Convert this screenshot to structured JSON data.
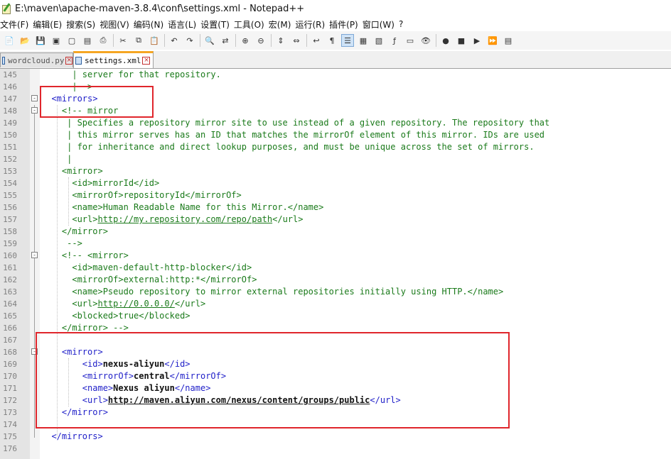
{
  "window": {
    "title": "E:\\maven\\apache-maven-3.8.4\\conf\\settings.xml - Notepad++"
  },
  "menu": [
    "文件(F)",
    "编辑(E)",
    "搜索(S)",
    "视图(V)",
    "编码(N)",
    "语言(L)",
    "设置(T)",
    "工具(O)",
    "宏(M)",
    "运行(R)",
    "插件(P)",
    "窗口(W)",
    "?"
  ],
  "toolbar": [
    {
      "name": "new-file-icon",
      "glyph": "📄"
    },
    {
      "name": "open-file-icon",
      "glyph": "📂"
    },
    {
      "name": "save-icon",
      "glyph": "💾"
    },
    {
      "name": "save-all-icon",
      "glyph": "▣"
    },
    {
      "name": "close-icon",
      "glyph": "▢"
    },
    {
      "name": "close-all-icon",
      "glyph": "▤"
    },
    {
      "name": "print-icon",
      "glyph": "⎙"
    },
    {
      "sep": true
    },
    {
      "name": "cut-icon",
      "glyph": "✂"
    },
    {
      "name": "copy-icon",
      "glyph": "⧉"
    },
    {
      "name": "paste-icon",
      "glyph": "📋"
    },
    {
      "sep": true
    },
    {
      "name": "undo-icon",
      "glyph": "↶"
    },
    {
      "name": "redo-icon",
      "glyph": "↷"
    },
    {
      "sep": true
    },
    {
      "name": "find-icon",
      "glyph": "🔍"
    },
    {
      "name": "replace-icon",
      "glyph": "⇄"
    },
    {
      "sep": true
    },
    {
      "name": "zoom-in-icon",
      "glyph": "⊕"
    },
    {
      "name": "zoom-out-icon",
      "glyph": "⊖"
    },
    {
      "sep": true
    },
    {
      "name": "sync-vertical-icon",
      "glyph": "⇕"
    },
    {
      "name": "sync-horizontal-icon",
      "glyph": "⇔"
    },
    {
      "sep": true
    },
    {
      "name": "word-wrap-icon",
      "glyph": "↩"
    },
    {
      "name": "show-all-chars-icon",
      "glyph": "¶"
    },
    {
      "name": "indent-guide-icon",
      "glyph": "☰",
      "pressed": true
    },
    {
      "name": "udl-icon",
      "glyph": "▦"
    },
    {
      "name": "doc-map-icon",
      "glyph": "▧"
    },
    {
      "name": "function-list-icon",
      "glyph": "ƒ"
    },
    {
      "name": "folder-workspace-icon",
      "glyph": "▭"
    },
    {
      "name": "monitoring-icon",
      "glyph": "👁"
    },
    {
      "sep": true
    },
    {
      "name": "record-macro-icon",
      "glyph": "●"
    },
    {
      "name": "stop-macro-icon",
      "glyph": "■"
    },
    {
      "name": "play-macro-icon",
      "glyph": "▶"
    },
    {
      "name": "run-macro-multiple-icon",
      "glyph": "⏩"
    },
    {
      "name": "save-macro-icon",
      "glyph": "▤"
    }
  ],
  "tabs": [
    {
      "label": "wordcloud.py",
      "active": false
    },
    {
      "label": "settings.xml",
      "active": true
    }
  ],
  "lines": [
    {
      "n": "145",
      "segs": [
        [
          "      | server for that repository.",
          "cm"
        ]
      ]
    },
    {
      "n": "146",
      "segs": [
        [
          "      |-->",
          "cm"
        ]
      ]
    },
    {
      "n": "147",
      "fold": "-",
      "segs": [
        [
          "  ",
          ""
        ],
        [
          "<mirrors>",
          "tag"
        ]
      ]
    },
    {
      "n": "148",
      "fold": "-",
      "segs": [
        [
          "    ",
          ""
        ],
        [
          "<!-- mirror",
          "cm"
        ]
      ]
    },
    {
      "n": "149",
      "segs": [
        [
          "     | Specifies a repository mirror site to use instead of a given repository. The repository that",
          "cm"
        ]
      ]
    },
    {
      "n": "150",
      "segs": [
        [
          "     | this mirror serves has an ID that matches the mirrorOf element of this mirror. IDs are used",
          "cm"
        ]
      ]
    },
    {
      "n": "151",
      "segs": [
        [
          "     | for inheritance and direct lookup purposes, and must be unique across the set of mirrors.",
          "cm"
        ]
      ]
    },
    {
      "n": "152",
      "segs": [
        [
          "     |",
          "cm"
        ]
      ]
    },
    {
      "n": "153",
      "segs": [
        [
          "    <mirror>",
          "cm"
        ]
      ]
    },
    {
      "n": "154",
      "segs": [
        [
          "      <id>mirrorId</id>",
          "cm"
        ]
      ]
    },
    {
      "n": "155",
      "segs": [
        [
          "      <mirrorOf>repositoryId</mirrorOf>",
          "cm"
        ]
      ]
    },
    {
      "n": "156",
      "segs": [
        [
          "      <name>Human Readable Name for this Mirror.</name>",
          "cm"
        ]
      ]
    },
    {
      "n": "157",
      "segs": [
        [
          "      <url>",
          "cm"
        ],
        [
          "http://my.repository.com/repo/path",
          "cm url"
        ],
        [
          "</url>",
          "cm"
        ]
      ]
    },
    {
      "n": "158",
      "segs": [
        [
          "    </mirror>",
          "cm"
        ]
      ]
    },
    {
      "n": "159",
      "segs": [
        [
          "     -->",
          "cm"
        ]
      ]
    },
    {
      "n": "160",
      "fold": "-",
      "segs": [
        [
          "    <!-- <mirror>",
          "cm"
        ]
      ]
    },
    {
      "n": "161",
      "segs": [
        [
          "      <id>maven-default-http-blocker</id>",
          "cm"
        ]
      ]
    },
    {
      "n": "162",
      "segs": [
        [
          "      <mirrorOf>external:http:*</mirrorOf>",
          "cm"
        ]
      ]
    },
    {
      "n": "163",
      "segs": [
        [
          "      <name>Pseudo repository to mirror external repositories initially using HTTP.</name>",
          "cm"
        ]
      ]
    },
    {
      "n": "164",
      "segs": [
        [
          "      <url>",
          "cm"
        ],
        [
          "http://0.0.0.0/",
          "cm url"
        ],
        [
          "</url>",
          "cm"
        ]
      ]
    },
    {
      "n": "165",
      "segs": [
        [
          "      <blocked>true</blocked>",
          "cm"
        ]
      ]
    },
    {
      "n": "166",
      "segs": [
        [
          "    </mirror> -->",
          "cm"
        ]
      ]
    },
    {
      "n": "167",
      "segs": []
    },
    {
      "n": "168",
      "fold": "-",
      "segs": [
        [
          "    ",
          ""
        ],
        [
          "<mirror>",
          "tag"
        ]
      ]
    },
    {
      "n": "169",
      "segs": [
        [
          "        ",
          ""
        ],
        [
          "<id>",
          "tag"
        ],
        [
          "nexus-aliyun",
          "txt bold"
        ],
        [
          "</id>",
          "tag"
        ]
      ]
    },
    {
      "n": "170",
      "segs": [
        [
          "        ",
          ""
        ],
        [
          "<mirrorOf>",
          "tag"
        ],
        [
          "central",
          "txt bold"
        ],
        [
          "</mirrorOf>",
          "tag"
        ]
      ]
    },
    {
      "n": "171",
      "segs": [
        [
          "        ",
          ""
        ],
        [
          "<name>",
          "tag"
        ],
        [
          "Nexus aliyun",
          "txt bold"
        ],
        [
          "</name>",
          "tag"
        ]
      ]
    },
    {
      "n": "172",
      "segs": [
        [
          "        ",
          ""
        ],
        [
          "<url>",
          "tag"
        ],
        [
          "http://maven.aliyun.com/nexus/content/groups/public",
          "txt bold url"
        ],
        [
          "</url>",
          "tag"
        ]
      ]
    },
    {
      "n": "173",
      "segs": [
        [
          "    ",
          ""
        ],
        [
          "</mirror>",
          "tag"
        ]
      ]
    },
    {
      "n": "174",
      "segs": []
    },
    {
      "n": "175",
      "segs": [
        [
          "  ",
          ""
        ],
        [
          "</mirrors>",
          "tag"
        ]
      ]
    },
    {
      "n": "176",
      "segs": []
    }
  ]
}
